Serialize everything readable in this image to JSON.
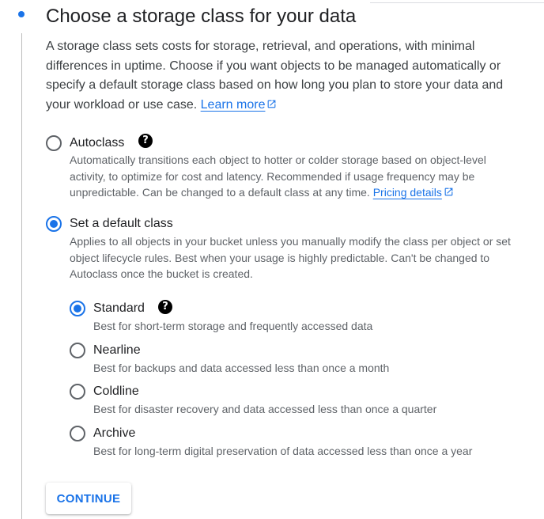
{
  "step": {
    "title": "Choose a storage class for your data",
    "intro": "A storage class sets costs for storage, retrieval, and operations, with minimal differences in uptime. Choose if you want objects to be managed automatically or specify a default storage class based on how long you plan to store your data and your workload or use case.",
    "learn_more": "Learn more"
  },
  "options": {
    "autoclass": {
      "label": "Autoclass",
      "checked": false,
      "description": "Automatically transitions each object to hotter or colder storage based on object-level activity, to optimize for cost and latency. Recommended if usage frequency may be unpredictable. Can be changed to a default class at any time.",
      "link": "Pricing details"
    },
    "default_class": {
      "label": "Set a default class",
      "checked": true,
      "description": "Applies to all objects in your bucket unless you manually modify the class per object or set object lifecycle rules. Best when your usage is highly predictable. Can't be changed to Autoclass once the bucket is created."
    }
  },
  "classes": [
    {
      "label": "Standard",
      "checked": true,
      "description": "Best for short-term storage and frequently accessed data"
    },
    {
      "label": "Nearline",
      "checked": false,
      "description": "Best for backups and data accessed less than once a month"
    },
    {
      "label": "Coldline",
      "checked": false,
      "description": "Best for disaster recovery and data accessed less than once a quarter"
    },
    {
      "label": "Archive",
      "checked": false,
      "description": "Best for long-term digital preservation of data accessed less than once a year"
    }
  ],
  "icons": {
    "help": "help-icon",
    "external_link": "open-in-new-icon",
    "step_marker": "step-dot-icon"
  },
  "colors": {
    "accent": "#1a73e8",
    "text": "#202124",
    "muted": "#5f6368"
  },
  "continue_label": "CONTINUE"
}
